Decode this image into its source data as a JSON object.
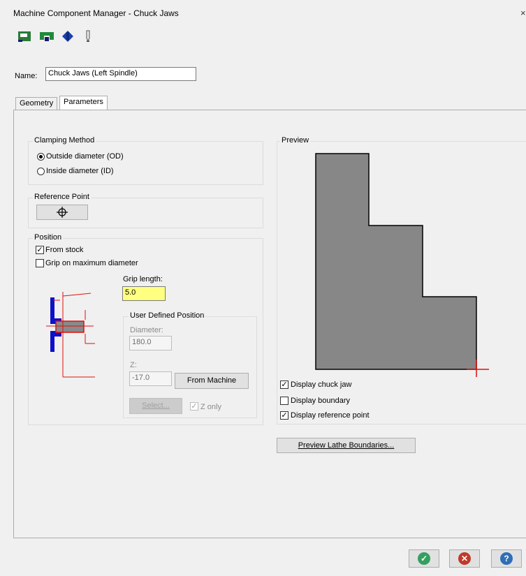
{
  "window": {
    "title": "Machine Component Manager - Chuck Jaws",
    "close_glyph": "×"
  },
  "toolbar": {
    "icons": [
      "chuck-jaw-icon",
      "jaw-clamp-icon",
      "spindle-icon",
      "tool-icon"
    ]
  },
  "name": {
    "label": "Name:",
    "value": "Chuck Jaws (Left Spindle)"
  },
  "tabs": [
    {
      "label": "Geometry"
    },
    {
      "label": "Parameters",
      "active": true
    }
  ],
  "clamping": {
    "label": "Clamping Method",
    "options": [
      {
        "label": "Outside diameter (OD)",
        "selected": true
      },
      {
        "label": "Inside diameter (ID)",
        "selected": false
      }
    ]
  },
  "reference": {
    "label": "Reference Point",
    "button_icon": "crosshair-icon"
  },
  "position": {
    "label": "Position",
    "from_stock": {
      "label": "From stock",
      "checked": true
    },
    "grip_max": {
      "label": "Grip on maximum diameter",
      "checked": false
    },
    "grip_length": {
      "label": "Grip length:",
      "value": "5.0"
    },
    "user_defined": {
      "label": "User Defined Position",
      "diameter_label": "Diameter:",
      "diameter_value": "180.0",
      "z_label": "Z:",
      "z_value": "-17.0",
      "from_machine": "From Machine",
      "select_button": "Select...",
      "z_only": {
        "label": "Z only",
        "checked": true
      }
    }
  },
  "preview": {
    "label": "Preview",
    "display_chuck_jaw": {
      "label": "Display chuck jaw",
      "checked": true
    },
    "display_boundary": {
      "label": "Display boundary",
      "checked": false
    },
    "display_reference_point": {
      "label": "Display reference point",
      "checked": true
    },
    "preview_button": "Preview Lathe Boundaries..."
  },
  "footer": {
    "ok": {
      "icon": "check-icon",
      "color": "#33a060"
    },
    "cancel": {
      "icon": "cancel-icon",
      "color": "#c0392b"
    },
    "help": {
      "icon": "help-icon",
      "color": "#2f6fb6"
    }
  },
  "colors": {
    "jaw_fill": "#878787",
    "ref_marker": "#e01010",
    "diagram_blue": "#1010c8",
    "diagram_red": "#e01010"
  }
}
